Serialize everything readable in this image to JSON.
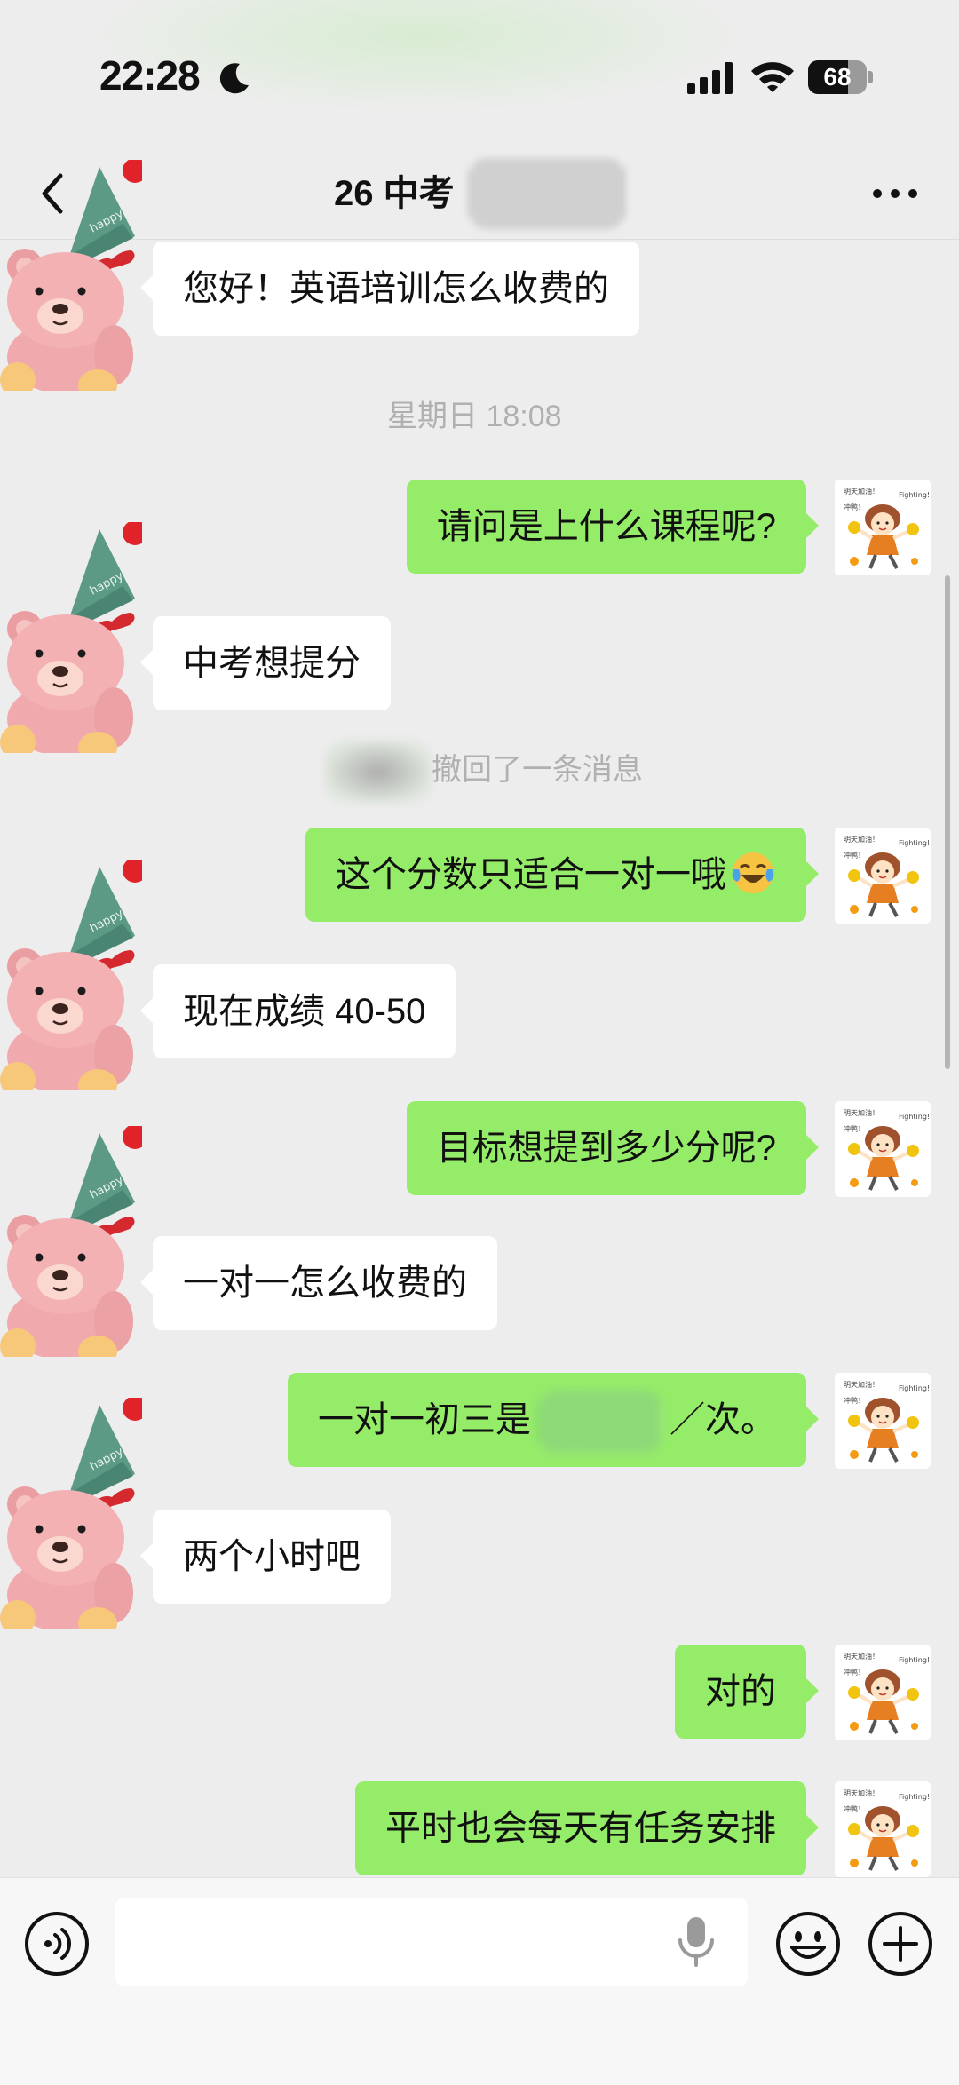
{
  "status_bar": {
    "time": "22:28",
    "battery": 68,
    "icons": [
      "moon-icon",
      "signal-icon",
      "wifi-icon",
      "battery-icon"
    ]
  },
  "nav": {
    "back_icon": "chevron-left-icon",
    "title": "26 中考",
    "more_icon": "ellipsis-icon"
  },
  "messages": [
    {
      "from": "them",
      "text": "您好！英语培训怎么收费的"
    },
    {
      "type": "timestamp",
      "text": "星期日 18:08"
    },
    {
      "from": "me",
      "text": "请问是上什么课程呢?"
    },
    {
      "from": "them",
      "text": "中考想提分"
    },
    {
      "type": "system",
      "text": "撤回了一条消息"
    },
    {
      "from": "me",
      "text": "这个分数只适合一对一哦",
      "emoji": "laugh-cry-emoji"
    },
    {
      "from": "them",
      "text": "现在成绩 40-50"
    },
    {
      "from": "me",
      "text": "目标想提到多少分呢?"
    },
    {
      "from": "them",
      "text": "一对一怎么收费的"
    },
    {
      "from": "me",
      "text_before": "一对一初三是",
      "text_after": "／次。"
    },
    {
      "from": "them",
      "text": "两个小时吧"
    },
    {
      "from": "me",
      "text": "对的"
    },
    {
      "from": "me",
      "text": "平时也会每天有任务安排"
    }
  ],
  "input_bar": {
    "value": "",
    "icons": [
      "voice-icon",
      "mic-icon",
      "emoji-icon",
      "plus-icon"
    ]
  },
  "colors": {
    "background": "#ededed",
    "outgoing_bubble": "#95ec69",
    "incoming_bubble": "#ffffff",
    "system_text": "#b0b0b0"
  }
}
